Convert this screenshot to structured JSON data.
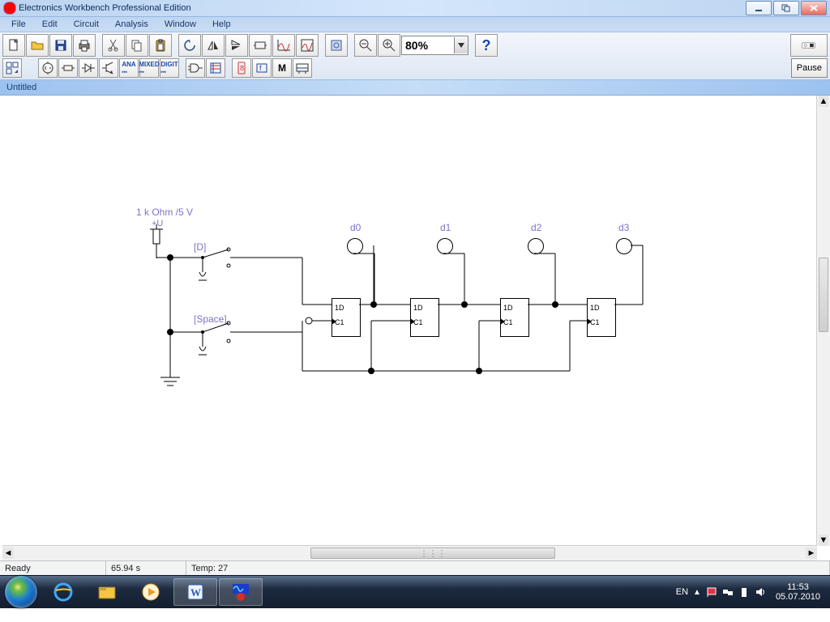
{
  "app": {
    "title": "Electronics Workbench Professional Edition"
  },
  "menu": {
    "items": [
      "File",
      "Edit",
      "Circuit",
      "Analysis",
      "Window",
      "Help"
    ]
  },
  "toolbar": {
    "zoom": "80%",
    "pause_label": "Pause"
  },
  "document": {
    "tab_title": "Untitled"
  },
  "circuit": {
    "source_label": "1 k Ohm /5 V",
    "source_rail": "+U",
    "switch_d_label": "[D]",
    "switch_space_label": "[Space]",
    "ff_pin_d": "1D",
    "ff_pin_c": "C1",
    "probes": [
      "d0",
      "d1",
      "d2",
      "d3"
    ]
  },
  "status": {
    "ready": "Ready",
    "sim_time": "65.94 s",
    "temp": "Temp: 27"
  },
  "taskbar": {
    "lang": "EN",
    "time": "11:53",
    "date": "05.07.2010"
  }
}
